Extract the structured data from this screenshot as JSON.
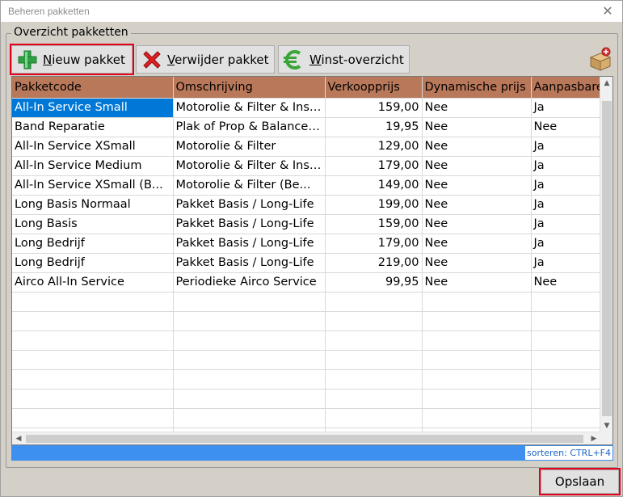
{
  "window": {
    "title": "Beheren pakketten",
    "close_glyph": "✕"
  },
  "group": {
    "legend": "Overzicht pakketten"
  },
  "toolbar": {
    "new_label": "Nieuw pakket",
    "delete_label": "Verwijder pakket",
    "profit_label": "Winst-overzicht",
    "new_icon": "plus-icon",
    "delete_icon": "red-x-icon",
    "profit_icon": "euro-icon",
    "package_icon": "package-icon"
  },
  "grid": {
    "columns": [
      "Pakketcode",
      "Omschrijving",
      "Verkoopprijs",
      "Dynamische prijs",
      "Aanpasbare"
    ],
    "rows": [
      {
        "code": "All-In Service Small",
        "desc": "Motorolie & Filter & Inspectie",
        "price": "159,00",
        "dynamic": "Nee",
        "adjustable": "Ja",
        "selected": true
      },
      {
        "code": "Band Reparatie",
        "desc": "Plak of Prop & Balanceren",
        "price": "19,95",
        "dynamic": "Nee",
        "adjustable": "Nee"
      },
      {
        "code": "All-In Service XSmall",
        "desc": "Motorolie & Filter",
        "price": "129,00",
        "dynamic": "Nee",
        "adjustable": "Ja"
      },
      {
        "code": "All-In Service Medium",
        "desc": "Motorolie & Filter & Inspectie",
        "price": "179,00",
        "dynamic": "Nee",
        "adjustable": "Ja"
      },
      {
        "code": "All-In Service XSmall (B...",
        "desc": "Motorolie & Filter (Be...",
        "price": "149,00",
        "dynamic": "Nee",
        "adjustable": "Ja"
      },
      {
        "code": "Long  Basis  Normaal",
        "desc": "Pakket Basis / Long-Life",
        "price": "199,00",
        "dynamic": "Nee",
        "adjustable": "Ja"
      },
      {
        "code": "Long Basis",
        "desc": "Pakket Basis / Long-Life",
        "price": "159,00",
        "dynamic": "Nee",
        "adjustable": "Ja"
      },
      {
        "code": "Long Bedrijf",
        "desc": "Pakket Basis / Long-Life",
        "price": "179,00",
        "dynamic": "Nee",
        "adjustable": "Ja"
      },
      {
        "code": "Long Bedrijf",
        "desc": "Pakket Basis / Long-Life",
        "price": "219,00",
        "dynamic": "Nee",
        "adjustable": "Ja"
      },
      {
        "code": "Airco All-In Service",
        "desc": "Periodieke Airco Service",
        "price": "99,95",
        "dynamic": "Nee",
        "adjustable": "Nee"
      }
    ],
    "empty_rows": 8
  },
  "statusbar": {
    "sort_hint": "sorteren: CTRL+F4"
  },
  "footer": {
    "save_label": "Opslaan"
  },
  "colors": {
    "header": "#b9785a",
    "selection": "#0078d7",
    "status": "#3d8ff0",
    "highlight": "#e3001b"
  }
}
